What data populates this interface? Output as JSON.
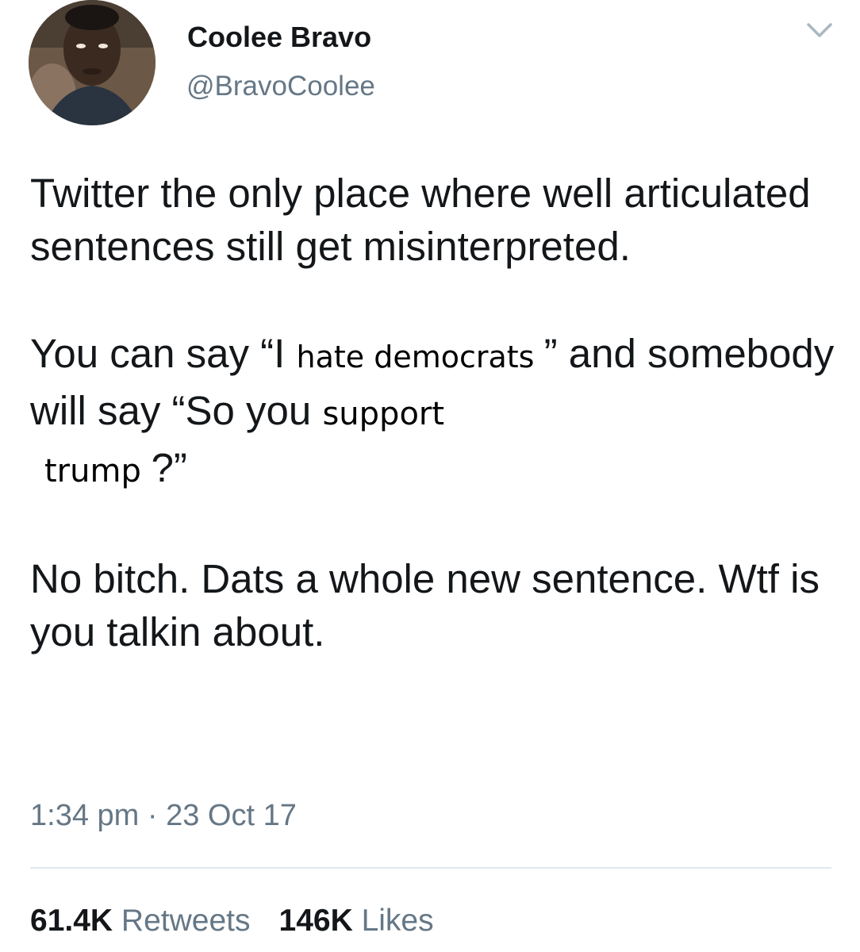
{
  "user": {
    "display_name": "Coolee Bravo",
    "handle": "@BravoCoolee",
    "avatar_icon": "profile-photo",
    "menu_icon": "chevron-down-icon"
  },
  "tweet": {
    "p1": "Twitter the only place where well articulated sentences still get misinterpreted.",
    "p2": {
      "a": "You can say “I ",
      "b": "hate democrats ",
      "c": "” and somebody will say “So you ",
      "d": "support",
      "e": "trump ",
      "f": "?”"
    },
    "p3": "No bitch. Dats a whole new sentence. Wtf is you talkin about."
  },
  "meta": {
    "timestamp": "1:34 pm · 23 Oct 17"
  },
  "stats": {
    "retweets_count": "61.4K",
    "retweets_label": "Retweets",
    "likes_count": "146K",
    "likes_label": "Likes"
  },
  "colors": {
    "text": "#14171a",
    "secondary": "#657786",
    "divider": "#e1e8ed"
  }
}
